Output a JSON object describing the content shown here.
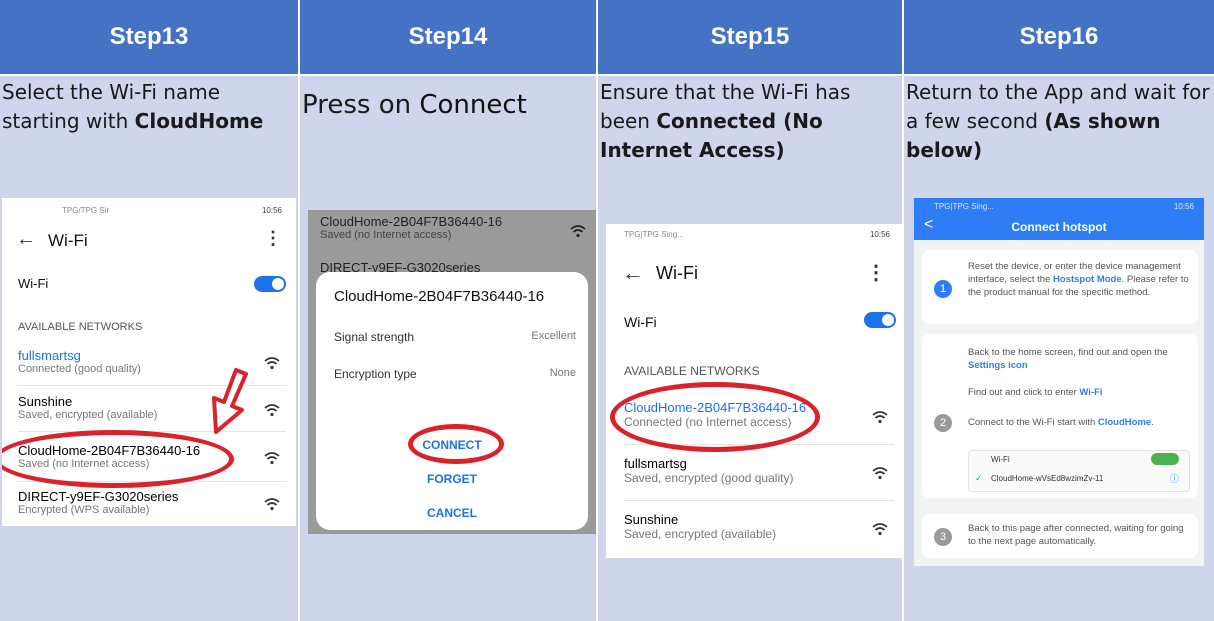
{
  "steps": [
    {
      "header": "Step13",
      "desc_plain": "Select the Wi-Fi name starting with ",
      "desc_bold": "CloudHome"
    },
    {
      "header": "Step14",
      "desc_plain": "Press on ",
      "desc_bold": "Connect"
    },
    {
      "header": "Step15",
      "desc_plain": "Ensure that the Wi-Fi has been ",
      "desc_bold": "Connected (No Internet Access)"
    },
    {
      "header": "Step16",
      "desc_plain": "Return to the App and wait for a few second ",
      "desc_bold": "(As shown below)"
    }
  ],
  "s13": {
    "status_left": "TPG/TPG Sir",
    "status_right": "10:56",
    "title": "Wi-Fi",
    "wifi_label": "Wi-Fi",
    "section": "AVAILABLE NETWORKS",
    "networks": [
      {
        "name": "fullsmartsg",
        "sub": "Connected (good quality)"
      },
      {
        "name": "Sunshine",
        "sub": "Saved, encrypted (available)"
      },
      {
        "name": "CloudHome-2B04F7B36440-16",
        "sub": "Saved (no Internet access)"
      },
      {
        "name": "DIRECT-y9EF-G3020series",
        "sub": "Encrypted (WPS available)"
      }
    ]
  },
  "s14": {
    "bg_net1_name": "CloudHome-2B04F7B36440-16",
    "bg_net1_sub": "Saved (no Internet access)",
    "bg_net2_name": "DIRECT-y9EF-G3020series",
    "dialog_title": "CloudHome-2B04F7B36440-16",
    "rows": [
      {
        "label": "Signal strength",
        "value": "Excellent"
      },
      {
        "label": "Encryption type",
        "value": "None"
      }
    ],
    "connect": "CONNECT",
    "forget": "FORGET",
    "cancel": "CANCEL"
  },
  "s15": {
    "status_left": "TPG|TPG Sing...",
    "status_right": "10:56",
    "title": "Wi-Fi",
    "wifi_label": "Wi-Fi",
    "section": "AVAILABLE NETWORKS",
    "networks": [
      {
        "name": "CloudHome-2B04F7B36440-16",
        "sub": "Connected (no Internet access)"
      },
      {
        "name": "fullsmartsg",
        "sub": "Saved, encrypted (good quality)"
      },
      {
        "name": "Sunshine",
        "sub": "Saved, encrypted (available)"
      }
    ]
  },
  "s16": {
    "status_left": "TPG|TPG Sing...",
    "status_right": "10:56",
    "title": "Connect hotspot",
    "card1": {
      "num": "1",
      "text_a": "Reset the device, or enter the device management interface, select the ",
      "text_link": "Hostspot Mode",
      "text_b": ". Please refer to the product manual for the specific method."
    },
    "card2": {
      "num": "2",
      "p1_a": "Back to the home screen, find out and open the ",
      "p1_link": "Settings icon",
      "p2_a": "Find out and click to enter ",
      "p2_link": "Wi-Fi",
      "p3_a": "Connect to the Wi-Fi start with ",
      "p3_link": "CloudHome",
      "p3_b": ".",
      "mini_wifi": "Wi-Fi",
      "mini_net": "CloudHome-wVsEd8wzimZv-11"
    },
    "card3": {
      "num": "3",
      "text": "Back to this page after connected, waiting for going to the next page automatically."
    }
  }
}
